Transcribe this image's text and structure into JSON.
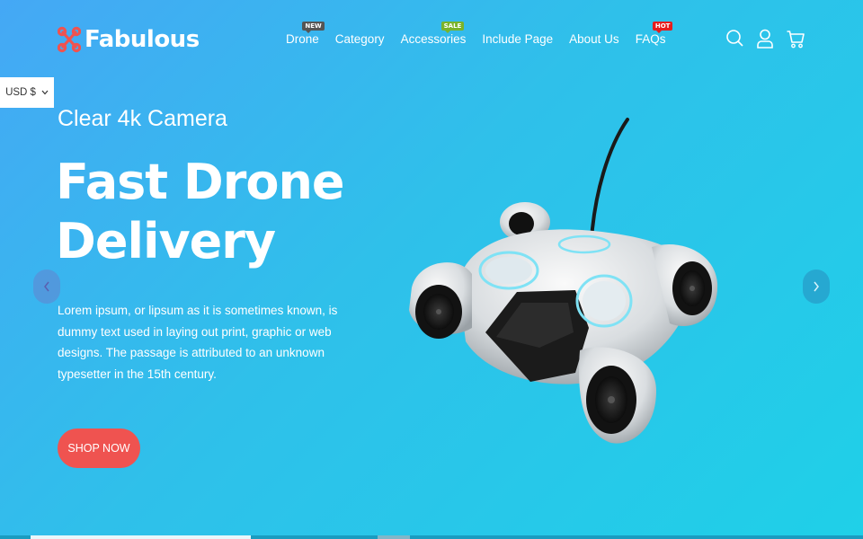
{
  "brand": {
    "name": "Fabulous",
    "accent": "#ef5350"
  },
  "nav": {
    "items": [
      {
        "label": "Drone",
        "badge": "NEW"
      },
      {
        "label": "Category",
        "badge": ""
      },
      {
        "label": "Accessories",
        "badge": "SALE"
      },
      {
        "label": "Include Page",
        "badge": ""
      },
      {
        "label": "About Us",
        "badge": ""
      },
      {
        "label": "FAQs",
        "badge": "HOT"
      }
    ]
  },
  "header_icons": [
    "search-icon",
    "user-icon",
    "cart-icon"
  ],
  "currency": {
    "label": "USD $"
  },
  "hero": {
    "subtitle": "Clear 4k Camera",
    "headline_line1": "Fast Drone",
    "headline_line2": "Delivery",
    "description": "Lorem ipsum, or lipsum as it is sometimes known, is dummy text used in laying out print, graphic or web designs. The passage is attributed to an unknown typesetter in the 15th century.",
    "cta": "SHOP NOW"
  },
  "slider": {
    "prev_icon": "chevron-left-icon",
    "next_icon": "chevron-right-icon"
  }
}
